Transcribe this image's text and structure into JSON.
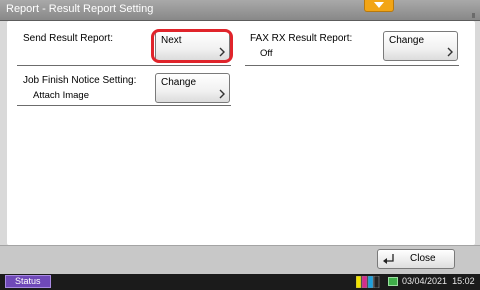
{
  "window": {
    "title": "Report - Result Report Setting"
  },
  "settings": {
    "send_result_report": {
      "label": "Send Result Report:",
      "button_label": "Next"
    },
    "fax_rx_result_report": {
      "label": "FAX RX Result Report:",
      "value": "Off",
      "button_label": "Change"
    },
    "job_finish_notice": {
      "label": "Job Finish Notice Setting:",
      "value": "Attach Image",
      "button_label": "Change"
    }
  },
  "footer": {
    "close_label": "Close"
  },
  "statusbar": {
    "status_label": "Status",
    "date": "03/04/2021",
    "time": "15:02"
  },
  "colors": {
    "highlight": "#e0242b",
    "status_button": "#6f49b8",
    "tab_indicator": "#f2a516"
  }
}
